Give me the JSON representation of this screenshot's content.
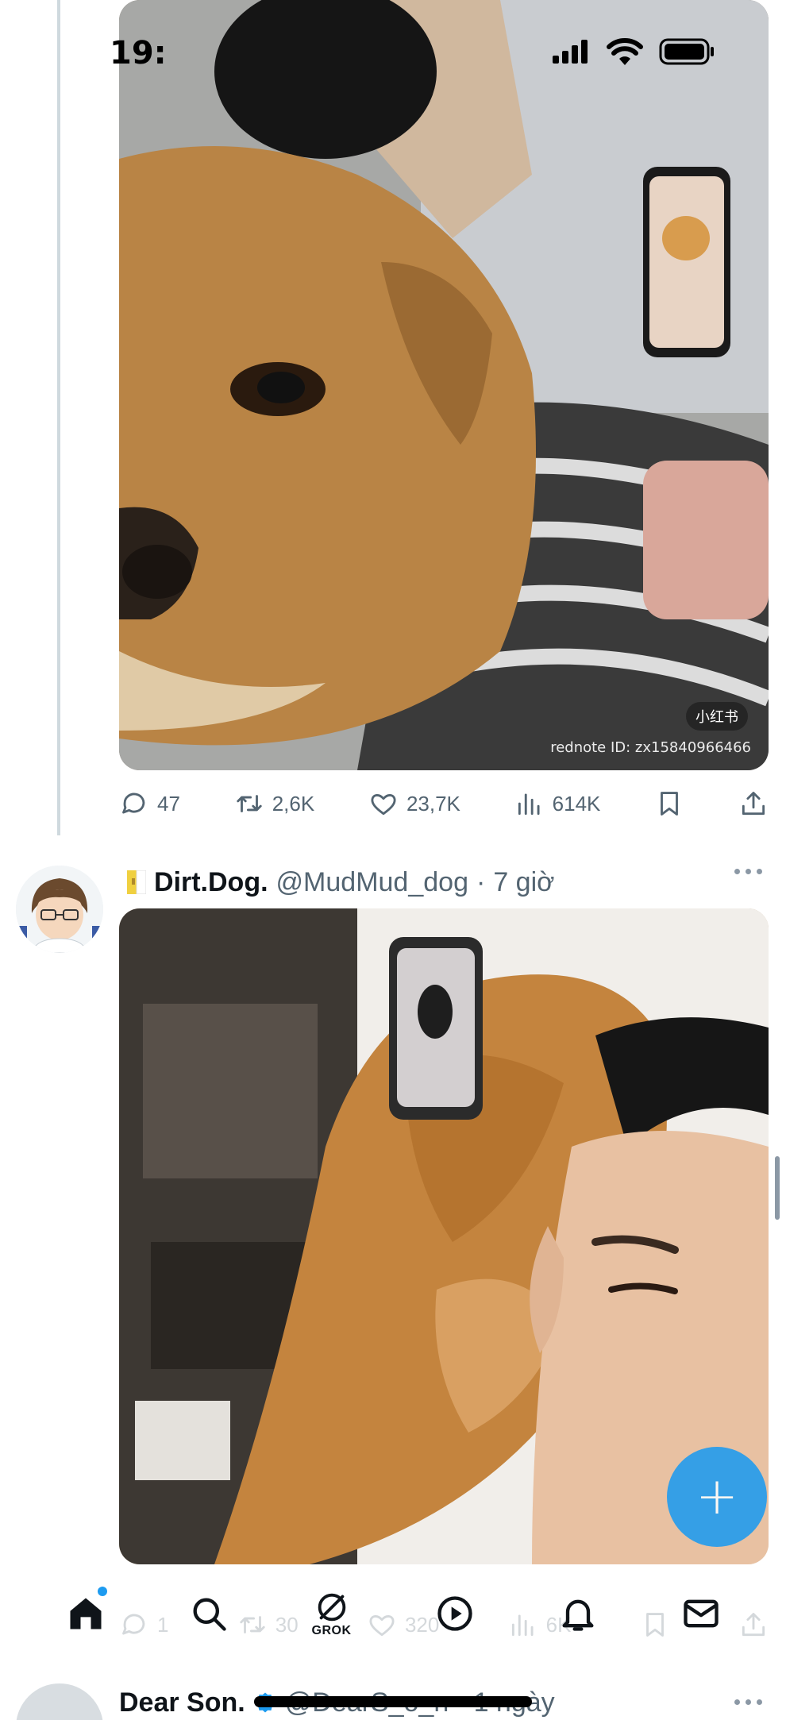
{
  "status_bar": {
    "time": "19:"
  },
  "tweet_top": {
    "media": {
      "watermark_badge": "小红书",
      "watermark_id": "rednote ID: zx15840966466"
    },
    "actions": {
      "replies": "47",
      "retweets": "2,6K",
      "likes": "23,7K",
      "views": "614K"
    }
  },
  "tweet_main": {
    "display_name": "Dirt.Dog.",
    "handle": "@MudMud_dog",
    "separator": "·",
    "time": "7 giờ",
    "actions": {
      "replies": "1",
      "retweets": "30",
      "likes": "320",
      "views": "6K"
    }
  },
  "tweet_next": {
    "display_name": "Dear Son.",
    "handle": "@DearS_o_n",
    "separator": "·",
    "time": "1 ngày"
  },
  "bottom_nav": {
    "grok_label": "GROK"
  },
  "fab": {
    "label": "+"
  },
  "colors": {
    "accent": "#1d9bf0",
    "text_secondary": "#536471",
    "thread_line": "#cfd9de"
  }
}
